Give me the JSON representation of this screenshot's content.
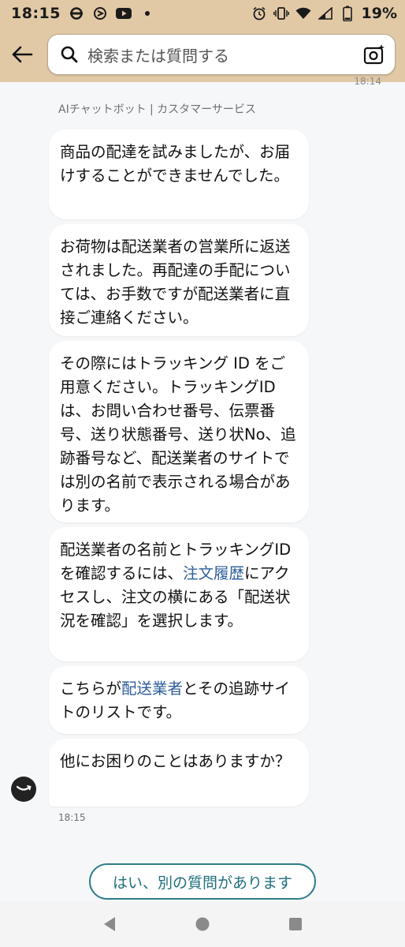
{
  "status_bar": {
    "time": "18:15",
    "battery": "19%",
    "left_icons": [
      "underground-icon",
      "app-icon",
      "youtube-icon",
      "dot-icon"
    ],
    "right_icons": [
      "alarm-icon",
      "vibrate-icon",
      "wifi-icon",
      "signal-icon",
      "battery-icon"
    ]
  },
  "header": {
    "search_placeholder": "検索または質問する"
  },
  "chat": {
    "previous_time": "18:14",
    "bot_label": "AIチャットボット | カスタマーサービス",
    "messages": [
      {
        "text": "商品の配達を試みましたが、お届けすることができませんでした。"
      },
      {
        "text": "お荷物は配送業者の営業所に返送されました。再配達の手配については、お手数ですが配送業者に直接ご連絡ください。"
      },
      {
        "text": "その際にはトラッキング ID をご用意ください。トラッキングIDは、お問い合わせ番号、伝票番号、送り状態番号、送り状No、追跡番号など、配送業者のサイトでは別の名前で表示される場合があります。"
      },
      {
        "before": "配送業者の名前とトラッキングIDを確認するには、",
        "link": "注文履歴",
        "after": "にアクセスし、注文の横にある「配送状況を確認」を選択します。"
      },
      {
        "before": "こちらが",
        "link": "配送業者",
        "after": "とその追跡サイトのリストです。"
      },
      {
        "text": "他にお困りのことはありますか？"
      }
    ],
    "message_time": "18:15",
    "quick_reply": "はい、別の質問があります"
  },
  "colors": {
    "header_bg": "#e2c9a6",
    "link": "#2d5e9c",
    "quick_reply_border": "#2f7e8c"
  }
}
